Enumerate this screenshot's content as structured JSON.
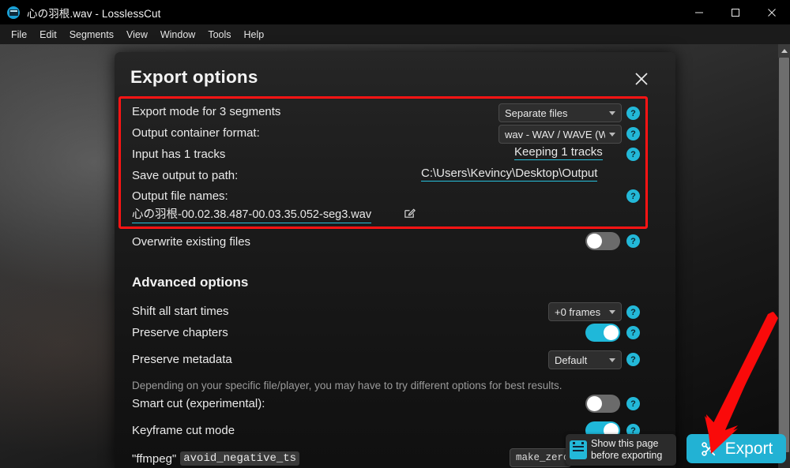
{
  "window": {
    "title": "心の羽根.wav - LosslessCut",
    "icon": "app-icon",
    "controls": [
      {
        "name": "minimize",
        "glyph": "minimize-icon"
      },
      {
        "name": "maximize",
        "glyph": "maximize-icon"
      },
      {
        "name": "close",
        "glyph": "close-icon"
      }
    ]
  },
  "menubar": {
    "items": [
      {
        "label": "File"
      },
      {
        "label": "Edit"
      },
      {
        "label": "Segments"
      },
      {
        "label": "View"
      },
      {
        "label": "Window"
      },
      {
        "label": "Tools"
      },
      {
        "label": "Help"
      }
    ]
  },
  "dialog": {
    "title": "Export options",
    "close_label": "×",
    "rows": {
      "export_mode": {
        "label": "Export mode for 3 segments",
        "value": "Separate files",
        "help": "?"
      },
      "container_format": {
        "label": "Output container format:",
        "value": "wav - WAV / WAVE (W",
        "help": "?"
      },
      "tracks": {
        "label": "Input has 1 tracks",
        "value": "Keeping 1 tracks",
        "help": "?"
      },
      "save_path": {
        "label": "Save output to path:",
        "value": "C:\\Users\\Kevincy\\Desktop\\Output"
      },
      "file_names": {
        "label": "Output file names:",
        "value": "心の羽根-00.02.38.487-00.03.35.052-seg3.wav",
        "edit_icon": "edit-icon",
        "help": "?"
      },
      "overwrite": {
        "label": "Overwrite existing files",
        "state": "off",
        "help": "?"
      }
    },
    "advanced": {
      "title": "Advanced options",
      "shift_start_times": {
        "label": "Shift all start times",
        "value": "+0 frames",
        "help": "?"
      },
      "preserve_chapters": {
        "label": "Preserve chapters",
        "state": "on",
        "help": "?"
      },
      "preserve_metadata": {
        "label": "Preserve metadata",
        "value": "Default",
        "help": "?"
      },
      "note": "Depending on your specific file/player, you may have to try different options for best results.",
      "smart_cut": {
        "label": "Smart cut (experimental):",
        "state": "off",
        "help": "?"
      },
      "keyframe_cut": {
        "label": "Keyframe cut mode",
        "state": "on",
        "help": "?"
      },
      "ffmpeg_flag": {
        "prefix": "\"ffmpeg\"",
        "code": "avoid_negative_ts",
        "value": "make_zero"
      }
    }
  },
  "tooltip": {
    "line1": "Show this page",
    "line2": "before exporting",
    "icon": "form-icon"
  },
  "export_button": {
    "label": "Export",
    "icon": "scissors-icon"
  },
  "annotation": {
    "arrow_color": "#fa0a0a",
    "highlight_color": "#ff1414"
  },
  "scrollbar": {
    "up_arrow": "chevron-up-icon"
  }
}
